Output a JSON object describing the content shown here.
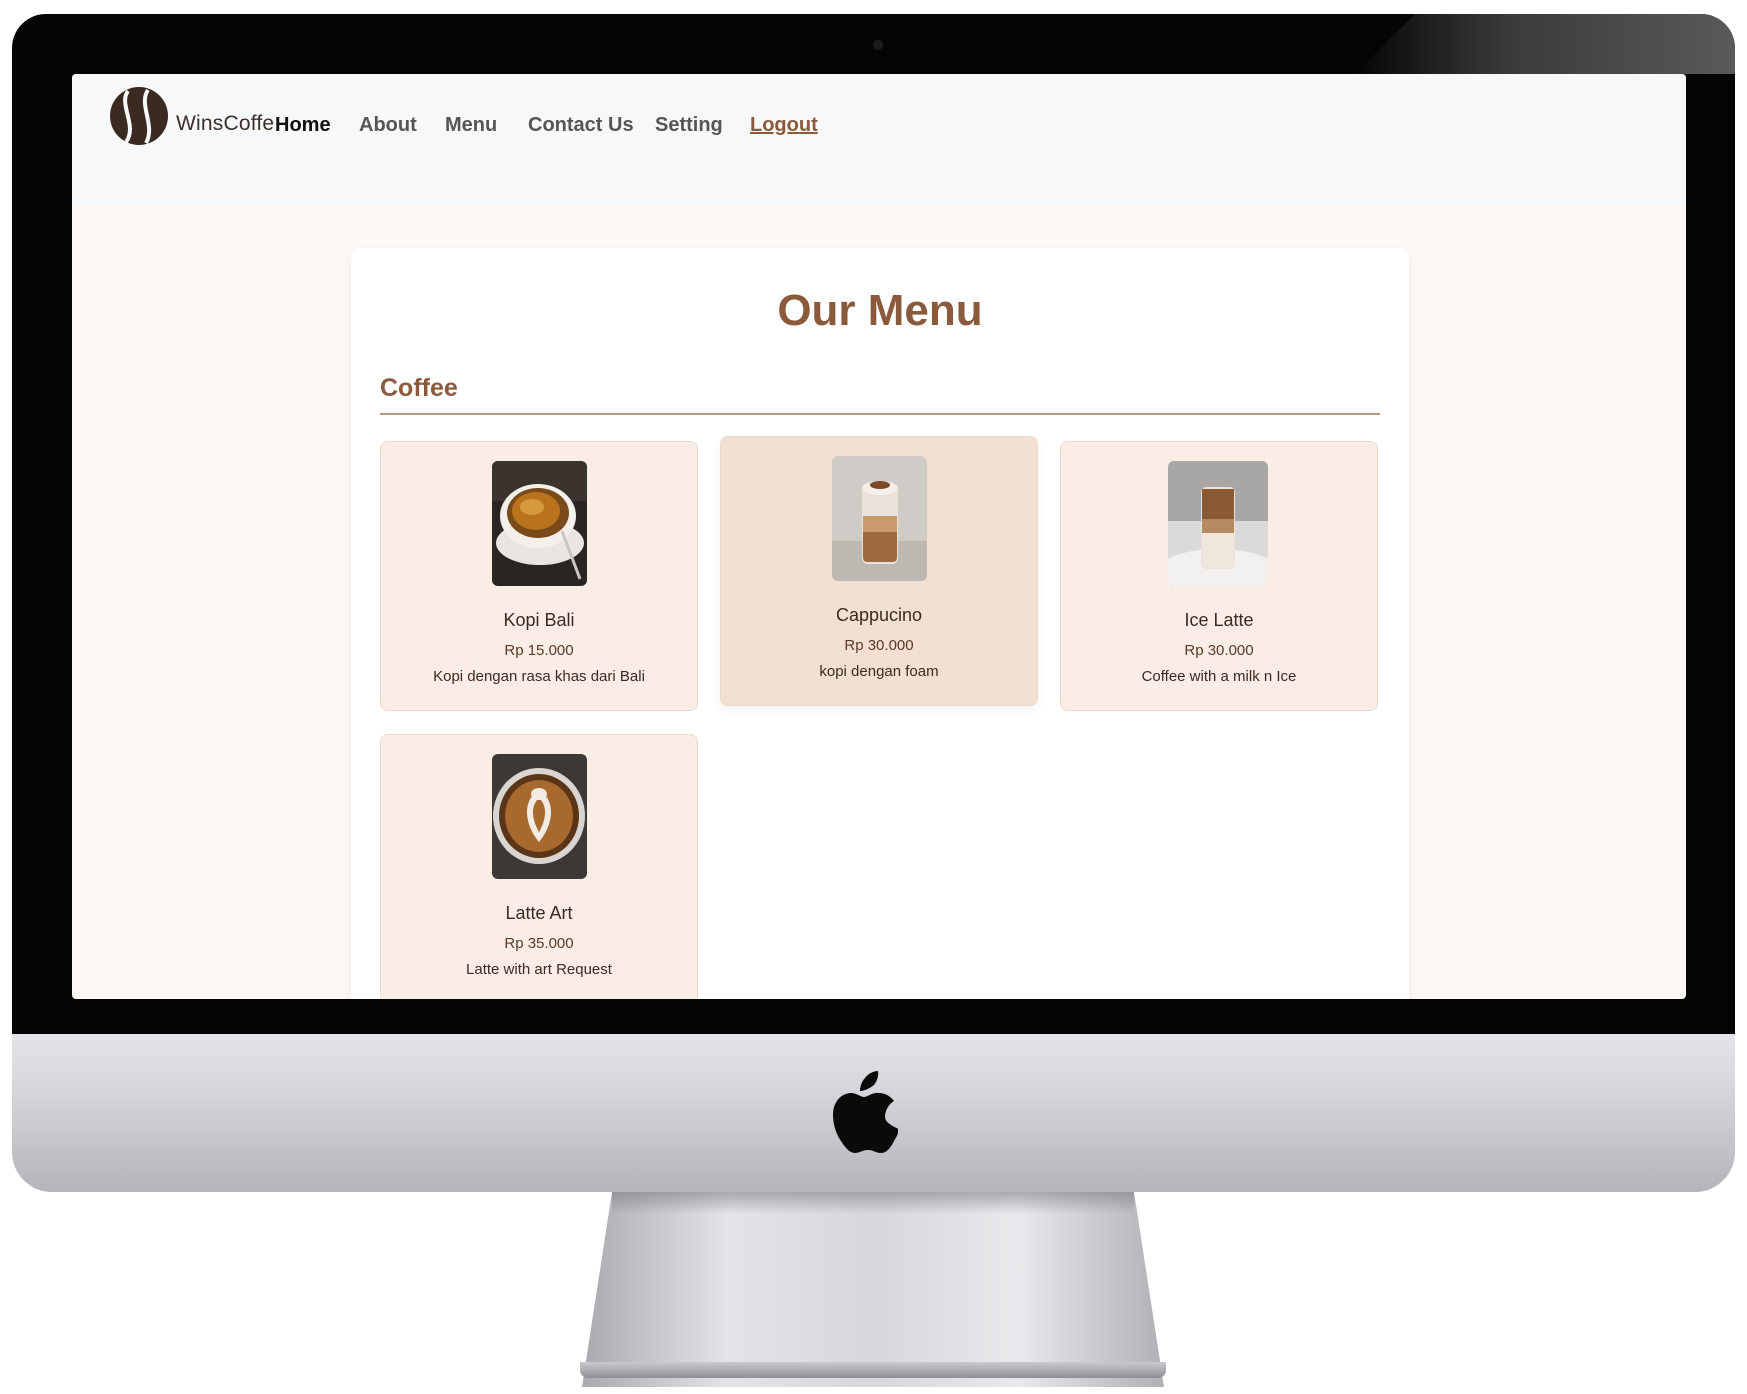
{
  "nav": {
    "brand": "WinsCoffe",
    "links": [
      {
        "label": "Home"
      },
      {
        "label": "About"
      },
      {
        "label": "Menu"
      },
      {
        "label": "Contact Us"
      },
      {
        "label": "Setting"
      },
      {
        "label": "Logout"
      }
    ]
  },
  "main": {
    "title": "Our Menu",
    "section": "Coffee",
    "items": [
      {
        "name": "Kopi Bali",
        "price": "Rp 15.000",
        "description": "Kopi dengan rasa khas dari Bali",
        "image": "hot-coffee-cup"
      },
      {
        "name": "Cappucino",
        "price": "Rp 30.000",
        "description": "kopi dengan foam",
        "image": "iced-cappuccino-glass"
      },
      {
        "name": "Ice Latte",
        "price": "Rp 30.000",
        "description": "Coffee with a milk n Ice",
        "image": "iced-latte-glass"
      },
      {
        "name": "Latte Art",
        "price": "Rp 35.000",
        "description": "Latte with art Request",
        "image": "latte-art-cup"
      }
    ]
  },
  "colors": {
    "accent": "#8b5a3c",
    "card_bg": "#f9ede5",
    "page_bg": "#fdf8f3",
    "nav_bg": "#f7f8f9"
  }
}
